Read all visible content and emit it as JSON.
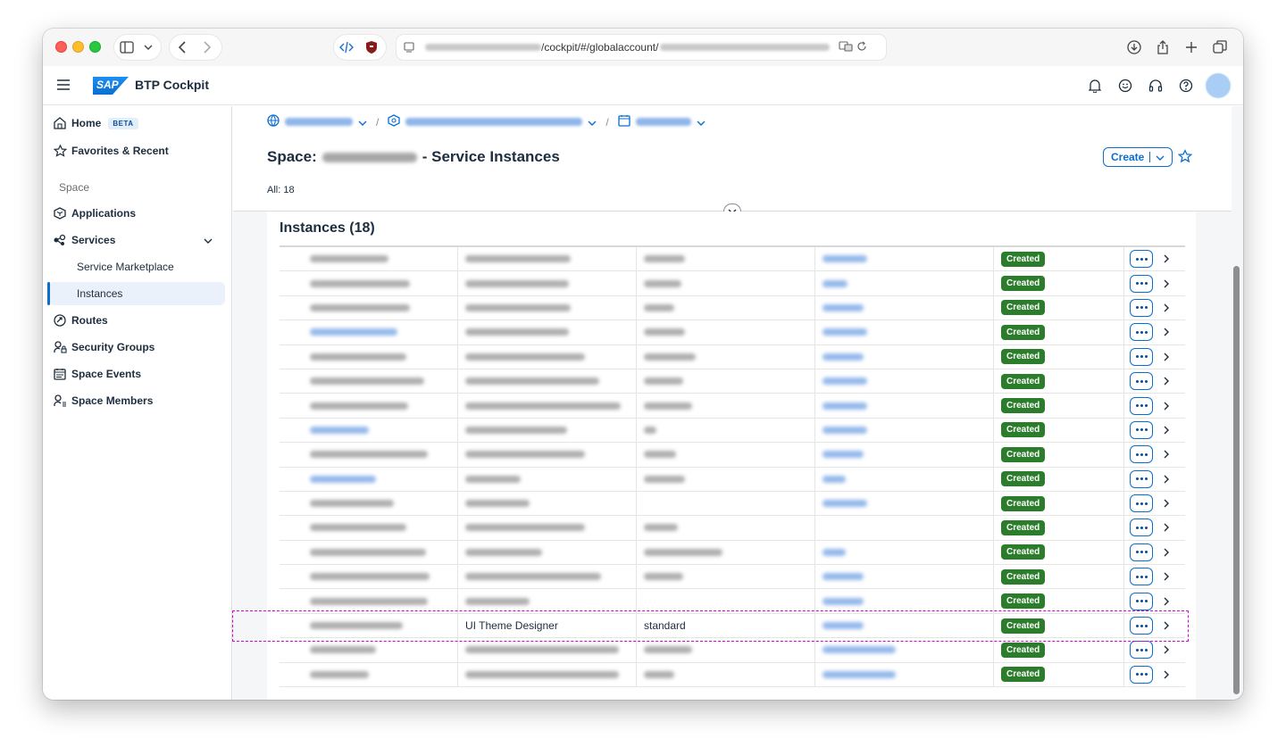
{
  "browser": {
    "url_visible_path": "/cockpit/#/globalaccount/"
  },
  "shell": {
    "logo_text": "SAP",
    "title": "BTP Cockpit"
  },
  "sidebar": {
    "home": "Home",
    "beta": "BETA",
    "favorites": "Favorites & Recent",
    "section": "Space",
    "items": [
      {
        "label": "Applications"
      },
      {
        "label": "Services"
      },
      {
        "label": "Service Marketplace"
      },
      {
        "label": "Instances"
      },
      {
        "label": "Routes"
      },
      {
        "label": "Security Groups"
      },
      {
        "label": "Space Events"
      },
      {
        "label": "Space Members"
      }
    ]
  },
  "header": {
    "title_prefix": "Space:",
    "title_suffix": "- Service Instances",
    "count": "All: 18",
    "create_label": "Create"
  },
  "table": {
    "title": "Instances (18)",
    "status": "Created",
    "highlight_row": {
      "service": "UI Theme Designer",
      "plan": "standard"
    }
  },
  "colors": {
    "accent": "#0a6ed1",
    "status_created": "#2b7d2b",
    "highlight": "#d400d4"
  }
}
